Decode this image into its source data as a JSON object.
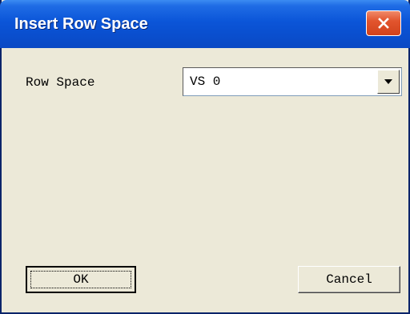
{
  "window": {
    "title": "Insert Row Space",
    "titlebar_color": "#0a4fcf",
    "close_icon": "close-icon"
  },
  "form": {
    "row_space_label": "Row Space",
    "row_space_value": "VS 0",
    "dropdown_icon": "chevron-down-icon"
  },
  "buttons": {
    "ok_label": "OK",
    "cancel_label": "Cancel"
  }
}
